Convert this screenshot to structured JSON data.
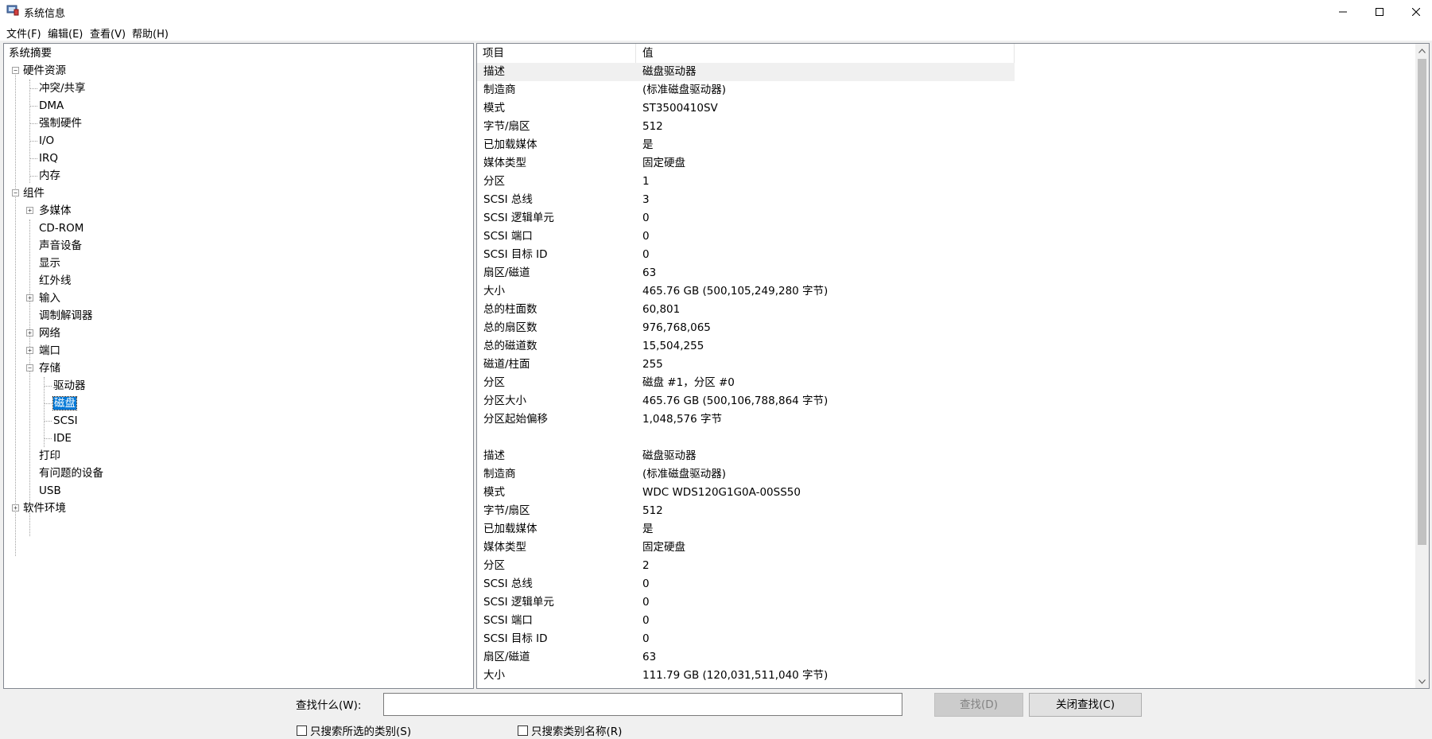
{
  "window": {
    "title": "系统信息"
  },
  "menu": [
    "文件(F)",
    "编辑(E)",
    "查看(V)",
    "帮助(H)"
  ],
  "tree": {
    "root": "系统摘要",
    "hardware": "硬件资源",
    "hardware_children": [
      "冲突/共享",
      "DMA",
      "强制硬件",
      "I/O",
      "IRQ",
      "内存"
    ],
    "components": "组件",
    "components_children": [
      "多媒体",
      "CD-ROM",
      "声音设备",
      "显示",
      "红外线",
      "输入",
      "调制解调器",
      "网络",
      "端口",
      "存储"
    ],
    "storage_children": [
      "驱动器",
      "磁盘",
      "SCSI",
      "IDE"
    ],
    "components_tail": [
      "打印",
      "有问题的设备",
      "USB"
    ],
    "software": "软件环境",
    "selected": "磁盘"
  },
  "table": {
    "headers": [
      "项目",
      "值"
    ],
    "rows": [
      [
        "描述",
        "磁盘驱动器"
      ],
      [
        "制造商",
        "(标准磁盘驱动器)"
      ],
      [
        "模式",
        "ST3500410SV"
      ],
      [
        "字节/扇区",
        "512"
      ],
      [
        "已加载媒体",
        "是"
      ],
      [
        "媒体类型",
        "固定硬盘"
      ],
      [
        "分区",
        "1"
      ],
      [
        "SCSI 总线",
        "3"
      ],
      [
        "SCSI 逻辑单元",
        "0"
      ],
      [
        "SCSI 端口",
        "0"
      ],
      [
        "SCSI 目标 ID",
        "0"
      ],
      [
        "扇区/磁道",
        "63"
      ],
      [
        "大小",
        "465.76 GB (500,105,249,280 字节)"
      ],
      [
        "总的柱面数",
        "60,801"
      ],
      [
        "总的扇区数",
        "976,768,065"
      ],
      [
        "总的磁道数",
        "15,504,255"
      ],
      [
        "磁道/柱面",
        "255"
      ],
      [
        "分区",
        "磁盘 #1，分区 #0"
      ],
      [
        "分区大小",
        "465.76 GB (500,106,788,864 字节)"
      ],
      [
        "分区起始偏移",
        "1,048,576 字节"
      ],
      [
        "",
        ""
      ],
      [
        "描述",
        "磁盘驱动器"
      ],
      [
        "制造商",
        "(标准磁盘驱动器)"
      ],
      [
        "模式",
        "WDC WDS120G1G0A-00SS50"
      ],
      [
        "字节/扇区",
        "512"
      ],
      [
        "已加载媒体",
        "是"
      ],
      [
        "媒体类型",
        "固定硬盘"
      ],
      [
        "分区",
        "2"
      ],
      [
        "SCSI 总线",
        "0"
      ],
      [
        "SCSI 逻辑单元",
        "0"
      ],
      [
        "SCSI 端口",
        "0"
      ],
      [
        "SCSI 目标 ID",
        "0"
      ],
      [
        "扇区/磁道",
        "63"
      ],
      [
        "大小",
        "111.79 GB (120,031,511,040 字节)"
      ]
    ]
  },
  "find": {
    "label": "查找什么(W):",
    "value": "",
    "find_button": "查找(D)",
    "close_button": "关闭查找(C)",
    "check_selected": "只搜索所选的类别(S)",
    "check_names": "只搜索类别名称(R)"
  }
}
